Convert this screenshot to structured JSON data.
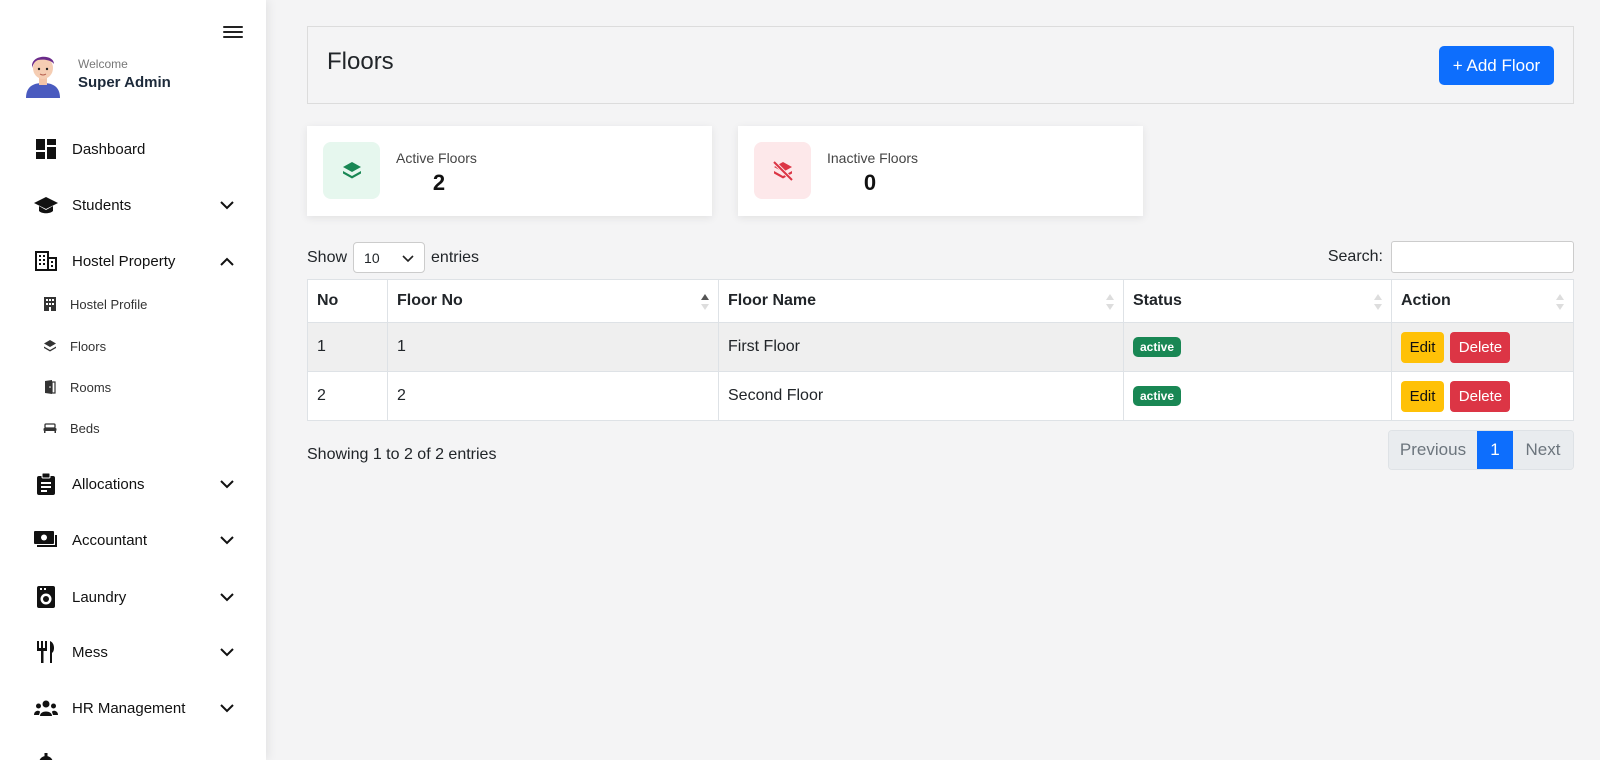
{
  "sidebar": {
    "welcome": "Welcome",
    "user_name": "Super Admin",
    "items": [
      {
        "label": "Dashboard"
      },
      {
        "label": "Students"
      },
      {
        "label": "Hostel Property"
      },
      {
        "label": "Allocations"
      },
      {
        "label": "Accountant"
      },
      {
        "label": "Laundry"
      },
      {
        "label": "Mess"
      },
      {
        "label": "HR Management"
      }
    ],
    "sub_items": [
      {
        "label": "Hostel Profile"
      },
      {
        "label": "Floors"
      },
      {
        "label": "Rooms"
      },
      {
        "label": "Beds"
      }
    ]
  },
  "header": {
    "title": "Floors",
    "add_label": "+ Add Floor"
  },
  "stats": {
    "active_label": "Active Floors",
    "active_value": "2",
    "inactive_label": "Inactive Floors",
    "inactive_value": "0"
  },
  "table_controls": {
    "show": "Show",
    "entries_value": "10",
    "entries": "entries",
    "search_label": "Search:",
    "search_value": ""
  },
  "table": {
    "columns": [
      "No",
      "Floor No",
      "Floor Name",
      "Status",
      "Action"
    ],
    "rows": [
      {
        "no": "1",
        "floor_no": "1",
        "floor_name": "First Floor",
        "status": "active",
        "edit": "Edit",
        "delete": "Delete"
      },
      {
        "no": "2",
        "floor_no": "2",
        "floor_name": "Second Floor",
        "status": "active",
        "edit": "Edit",
        "delete": "Delete"
      }
    ]
  },
  "footer": {
    "info": "Showing 1 to 2 of 2 entries",
    "prev": "Previous",
    "page": "1",
    "next": "Next"
  },
  "colors": {
    "primary": "#0d6efd",
    "success": "#198754",
    "warning": "#ffc107",
    "danger": "#dc3545",
    "active_icon_bg": "#e6f7ee",
    "inactive_icon_bg": "#fde8ea"
  }
}
